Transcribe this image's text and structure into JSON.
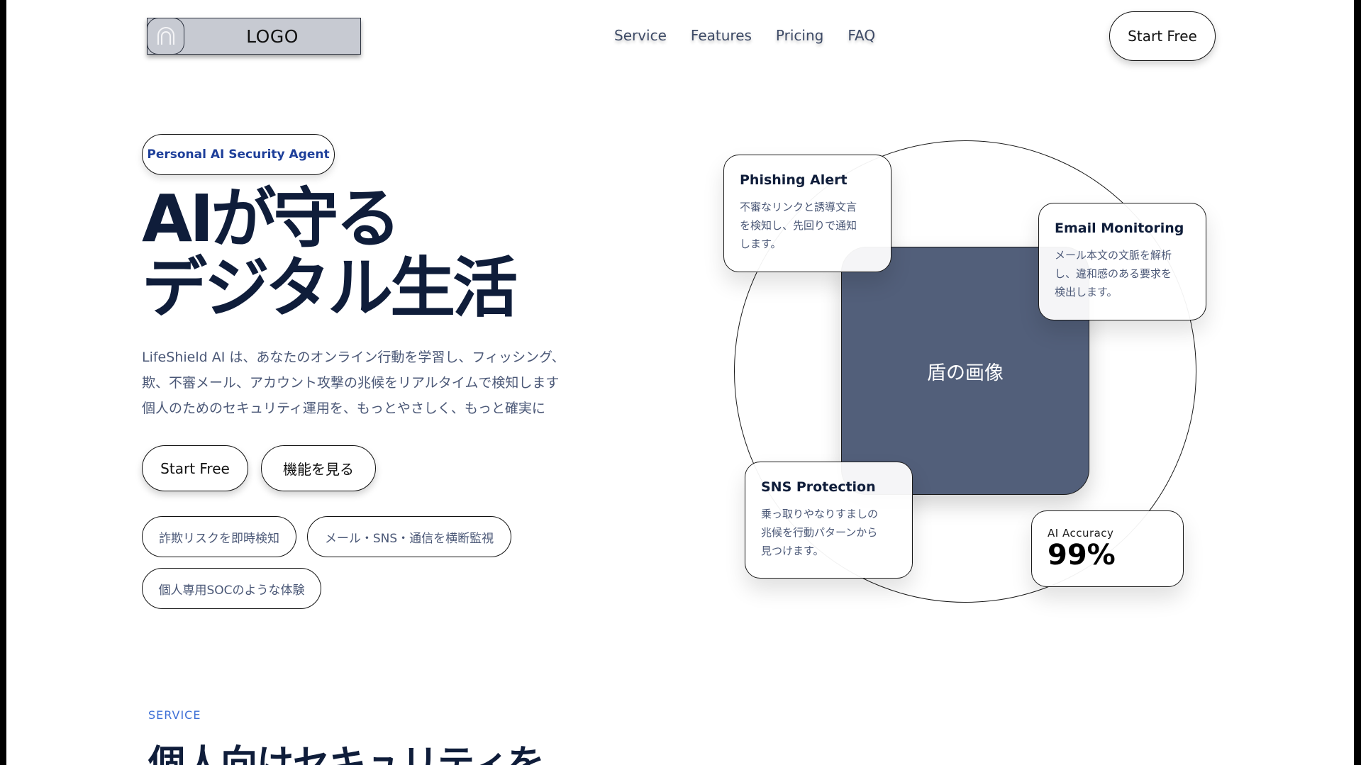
{
  "header": {
    "logo_text": "LOGO",
    "nav": [
      "Service",
      "Features",
      "Pricing",
      "FAQ"
    ],
    "cta": "Start Free"
  },
  "hero": {
    "badge": "Personal AI Security Agent",
    "title_lines": [
      "AIが守る",
      "デジタル生活"
    ],
    "desc_lines": [
      "LifeShield AI は、あなたのオンライン行動を学習し、フィッシング、",
      "欺、不審メール、アカウント攻撃の兆候をリアルタイムで検知します",
      "個人のためのセキュリティ運用を、もっとやさしく、もっと確実に"
    ],
    "primary_button": "Start Free",
    "secondary_button": "機能を見る",
    "tags": [
      "詐欺リスクを即時検知",
      "メール・SNS・通信を横断監視",
      "個人専用SOCのような体験"
    ]
  },
  "visual": {
    "shield_placeholder": "盾の画像",
    "cards": {
      "phishing": {
        "title": "Phishing Alert",
        "lines": [
          "不審なリンクと誘導文言",
          "を検知し、先回りで通知",
          "します。"
        ]
      },
      "email": {
        "title": "Email Monitoring",
        "lines": [
          "メール本文の文脈を解析",
          "し、違和感のある要求を",
          "検出します。"
        ]
      },
      "sns": {
        "title": "SNS Protection",
        "lines": [
          "乗っ取りやなりすましの",
          "兆候を行動パターンから",
          "見つけます。"
        ]
      }
    },
    "accuracy": {
      "label": "AI Accuracy",
      "value": "99%"
    }
  },
  "service": {
    "label": "SERVICE",
    "title": "個人向けセキュリティを"
  }
}
